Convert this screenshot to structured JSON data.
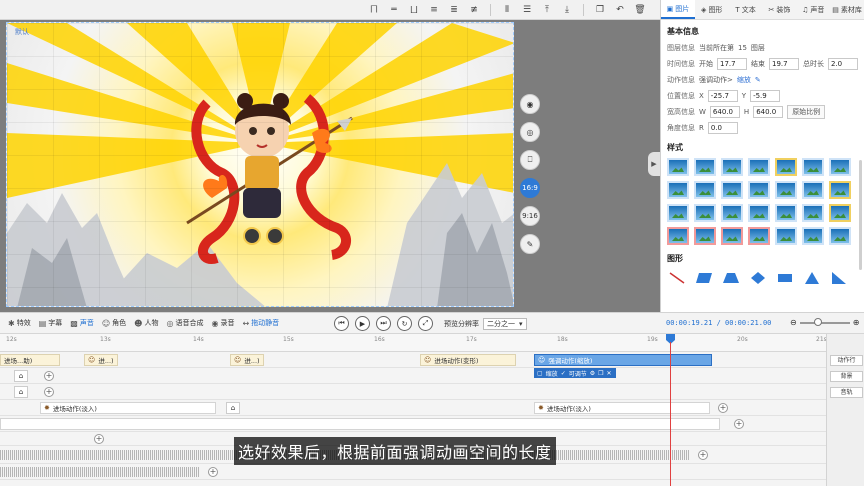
{
  "canvas": {
    "default_label": "默认",
    "ratio_16_9": "16:9",
    "ratio_9_16": "9:16"
  },
  "panel": {
    "tabs": [
      {
        "label": "图片",
        "icon": "image-icon"
      },
      {
        "label": "图形",
        "icon": "shape-icon"
      },
      {
        "label": "文本",
        "icon": "text-icon"
      },
      {
        "label": "装饰",
        "icon": "decoration-icon"
      },
      {
        "label": "声音",
        "icon": "sound-icon"
      },
      {
        "label": "素材库",
        "icon": "library-icon"
      }
    ],
    "basic_info_title": "基本信息",
    "scene_info": {
      "key": "图层信息",
      "text": "当前所在第",
      "value": "15",
      "suffix": "图层"
    },
    "time_info": {
      "key": "时间信息",
      "start_label": "开始",
      "start": "17.7",
      "end_label": "结束",
      "end": "19.7",
      "total_label": "总时长",
      "total": "2.0"
    },
    "action_info": {
      "key": "动作信息",
      "action": "强调动作>",
      "effect": "缩放"
    },
    "position_info": {
      "key": "位置信息",
      "x_label": "X",
      "x": "-25.7",
      "y_label": "Y",
      "y": "-5.9"
    },
    "size_info": {
      "key": "宽高信息",
      "w_label": "W",
      "w": "640.0",
      "h_label": "H",
      "h": "640.0",
      "reset": "原始比例"
    },
    "angle_info": {
      "key": "角度信息",
      "r_label": "R",
      "r": "0.0"
    },
    "styles_title": "样式",
    "shapes_title": "图形"
  },
  "timeline": {
    "tools": [
      {
        "label": "特效",
        "icon": "effects-icon"
      },
      {
        "label": "字幕",
        "icon": "subtitle-icon"
      },
      {
        "label": "声音",
        "icon": "sound-icon"
      },
      {
        "label": "角色",
        "icon": "character-icon"
      },
      {
        "label": "人物",
        "icon": "person-icon"
      },
      {
        "label": "语音合成",
        "icon": "tts-icon"
      },
      {
        "label": "录音",
        "icon": "record-icon"
      },
      {
        "label": "拖动静音",
        "icon": "drag-mute-icon"
      }
    ],
    "preview_label": "预览分辨率",
    "preview_value": "二分之一",
    "current_time": "00:00:19.21",
    "total_time": "00:00:21.00",
    "ruler": [
      "12s",
      "13s",
      "14s",
      "15s",
      "16s",
      "17s",
      "18s",
      "19s",
      "20s",
      "21s"
    ],
    "clips": {
      "c1": "进场...助)",
      "c2": "进...)",
      "c3": "进...)",
      "c4": "进场动作(变形)",
      "c5": "强调动作(缩放)",
      "c6": "进场动作(淡入)",
      "c7": "进场动作(淡入)"
    },
    "sub_toolbar": "缩放",
    "sub_toolbar_2": "可调节",
    "track_labels": {
      "action_row": "动作行",
      "background": "背景",
      "music": "音轨"
    }
  },
  "subtitle": "选好效果后，根据前面强调动画空间的长度"
}
